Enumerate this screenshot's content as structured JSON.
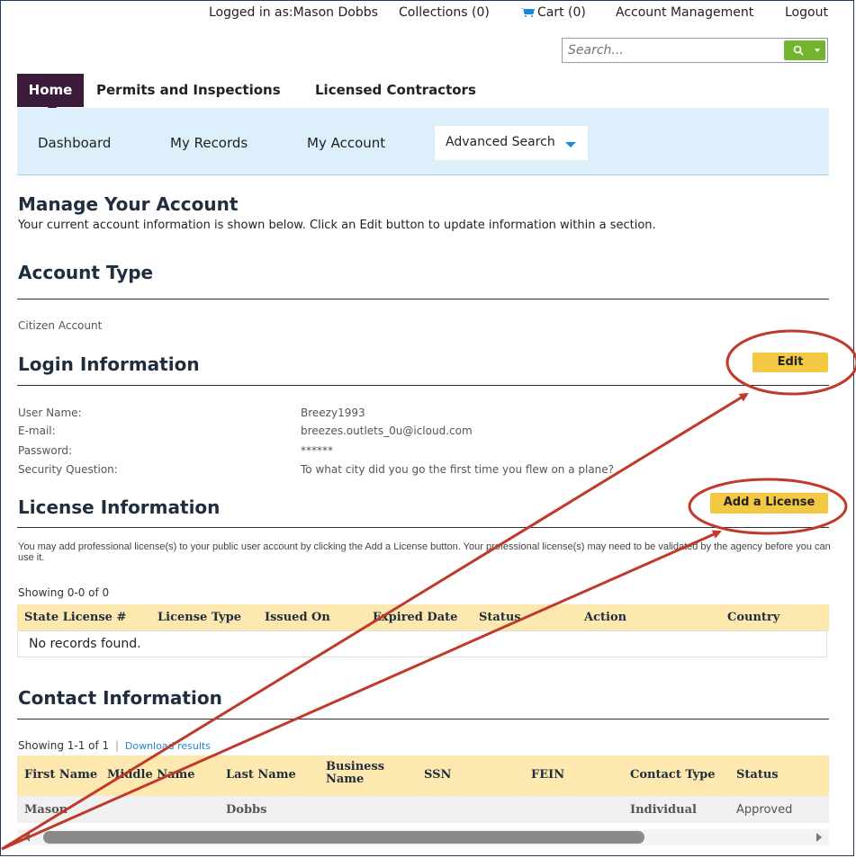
{
  "topbar": {
    "logged_in": "Logged in as:Mason Dobbs",
    "collections": "Collections (0)",
    "cart": "Cart (0)",
    "account_management": "Account Management",
    "logout": "Logout"
  },
  "search": {
    "placeholder": "Search..."
  },
  "main_nav": {
    "home": "Home",
    "permits": "Permits and Inspections",
    "contractors": "Licensed Contractors"
  },
  "sub_nav": {
    "dashboard": "Dashboard",
    "my_records": "My Records",
    "my_account": "My Account",
    "advanced_search": "Advanced Search"
  },
  "page": {
    "title": "Manage Your Account",
    "intro": "Your current account information is shown below. Click an Edit button to update information within a section."
  },
  "account_type": {
    "heading": "Account Type",
    "value": "Citizen Account"
  },
  "login_info": {
    "heading": "Login Information",
    "edit_label": "Edit",
    "fields": [
      {
        "label": "User Name:",
        "value": "Breezy1993"
      },
      {
        "label": "E-mail:",
        "value": "breezes.outlets_0u@icloud.com"
      },
      {
        "label": "Password:",
        "value": "******"
      },
      {
        "label": "Security Question:",
        "value": "To what city did you go the first time you flew on a plane?"
      }
    ]
  },
  "license_info": {
    "heading": "License Information",
    "add_label": "Add a License",
    "description": "You may add professional license(s) to your public user account by clicking the Add a License button. Your professional license(s) may need to be validated by the agency before you can use it.",
    "showing": "Showing 0-0 of 0",
    "columns": [
      "State License #",
      "License Type",
      "Issued On",
      "Expired Date",
      "Status",
      "Action",
      "Country"
    ],
    "empty": "No records found."
  },
  "contact_info": {
    "heading": "Contact Information",
    "showing": "Showing 1-1 of 1",
    "separator": "|",
    "download": "Download results",
    "columns": [
      "First Name",
      "Middle Name",
      "Last Name",
      "Business Name",
      "SSN",
      "FEIN",
      "Contact Type",
      "Status"
    ],
    "rows": [
      {
        "first": "Mason",
        "middle": "",
        "last": "Dobbs",
        "business": "",
        "ssn": "",
        "fein": "",
        "type": "Individual",
        "status": "Approved"
      }
    ]
  },
  "colors": {
    "accent_button": "#f3c842",
    "nav_active": "#3c1a3a",
    "subnav_bg": "#ddeffa",
    "table_header": "#fde9b0",
    "annotation": "#c0392b"
  }
}
